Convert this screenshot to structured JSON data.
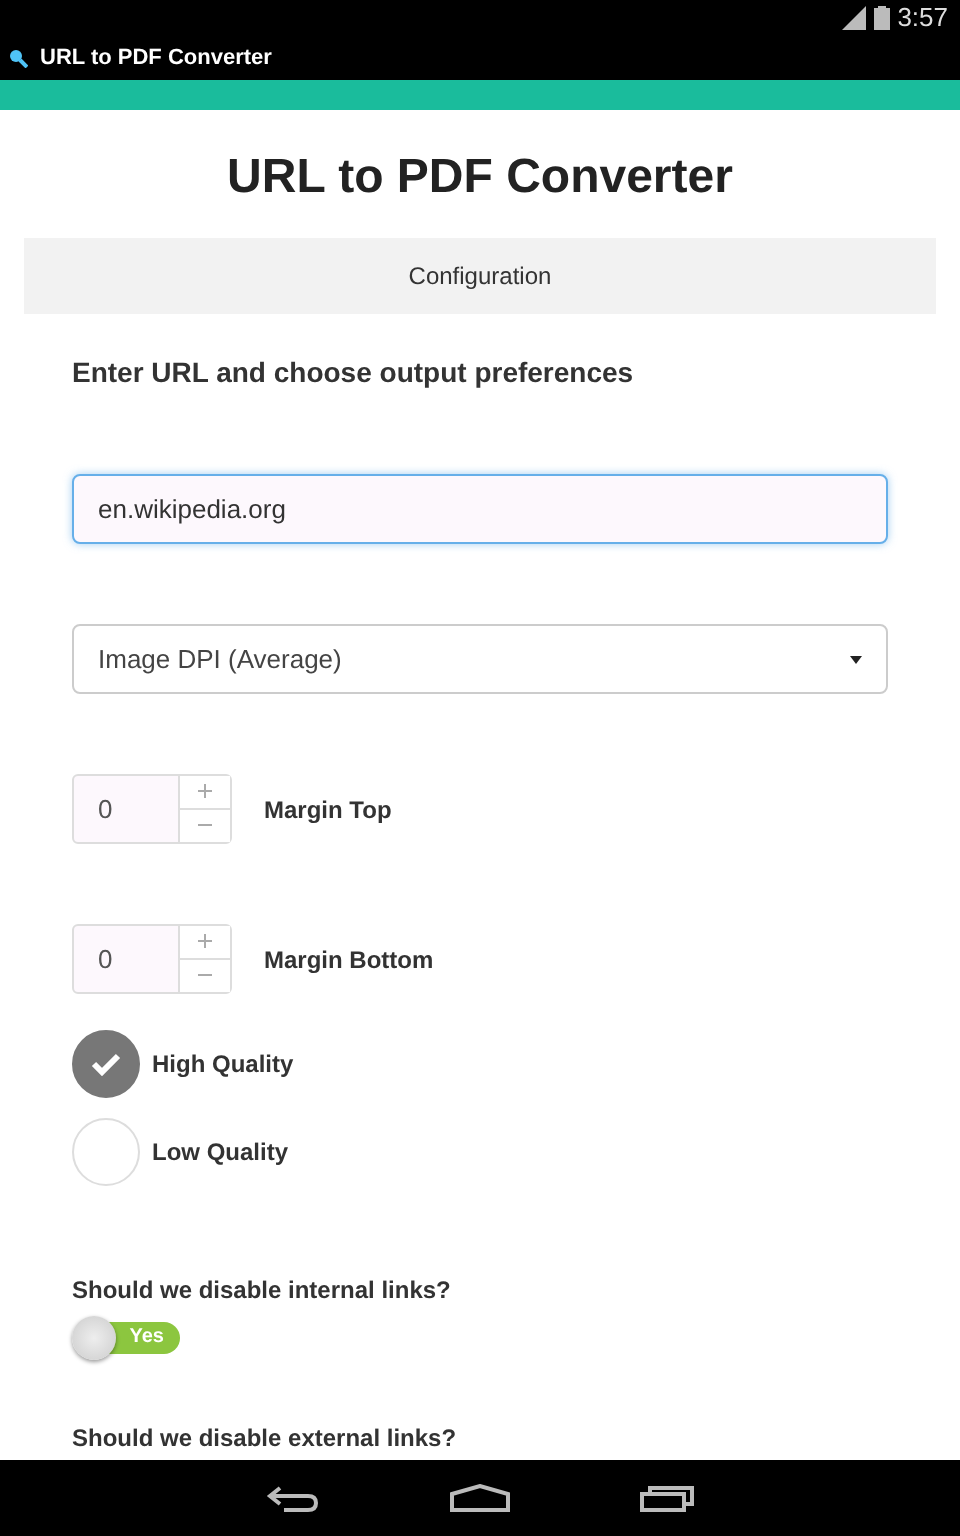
{
  "status_bar": {
    "time": "3:57"
  },
  "action_bar": {
    "title": "URL to PDF Converter"
  },
  "page": {
    "title": "URL to PDF Converter",
    "section": "Configuration",
    "heading": "Enter URL and choose output preferences"
  },
  "url_field": {
    "value": "en.wikipedia.org"
  },
  "dpi_select": {
    "value": "Image DPI (Average)"
  },
  "spinners": [
    {
      "value": "0",
      "label": "Margin Top"
    },
    {
      "value": "0",
      "label": "Margin Bottom"
    }
  ],
  "quality": [
    {
      "label": "High Quality",
      "selected": true
    },
    {
      "label": "Low Quality",
      "selected": false
    }
  ],
  "toggles": [
    {
      "question": "Should we disable internal links?",
      "on": true,
      "state_label": "Yes"
    },
    {
      "question": "Should we disable external links?"
    }
  ]
}
